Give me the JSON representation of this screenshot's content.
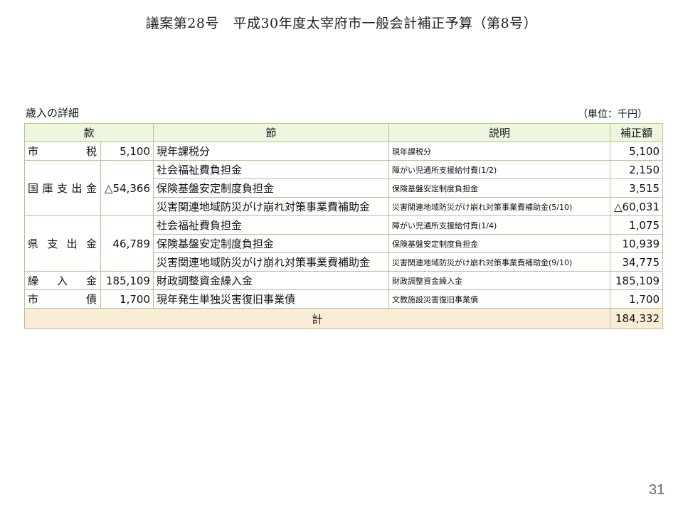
{
  "title": "議案第28号　平成30年度太宰府市一般会計補正予算（第8号）",
  "section_label": "歳入の詳細",
  "unit_label": "（単位：千円）",
  "headers": {
    "kan": "款",
    "setsu": "節",
    "setsumei": "説明",
    "hoseigaku": "補正額"
  },
  "groups": [
    {
      "kan": "市　　税",
      "kan_amount": "5,100",
      "rows": [
        {
          "setsu": "現年課税分",
          "setsumei": "現年課税分",
          "amount": "5,100"
        }
      ]
    },
    {
      "kan": "国庫支出金",
      "kan_amount": "△54,366",
      "rows": [
        {
          "setsu": "社会福祉費負担金",
          "setsumei": "障がい児通所支援給付費(1/2)",
          "amount": "2,150"
        },
        {
          "setsu": "保険基盤安定制度負担金",
          "setsumei": "保険基盤安定制度負担金",
          "amount": "3,515"
        },
        {
          "setsu": "災害関連地域防災がけ崩れ対策事業費補助金",
          "setsumei": "災害関連地域防災がけ崩れ対策事業費補助金(5/10)",
          "amount": "△60,031"
        }
      ]
    },
    {
      "kan": "県支出金",
      "kan_amount": "46,789",
      "rows": [
        {
          "setsu": "社会福祉費負担金",
          "setsumei": "障がい児通所支援給付費(1/4)",
          "amount": "1,075"
        },
        {
          "setsu": "保険基盤安定制度負担金",
          "setsumei": "保険基盤安定制度負担金",
          "amount": "10,939"
        },
        {
          "setsu": "災害関連地域防災がけ崩れ対策事業費補助金",
          "setsumei": "災害関連地域防災がけ崩れ対策事業費補助金(9/10)",
          "amount": "34,775"
        }
      ]
    },
    {
      "kan": "繰入金",
      "kan_amount": "185,109",
      "rows": [
        {
          "setsu": "財政調整資金繰入金",
          "setsumei": "財政調整資金繰入金",
          "amount": "185,109"
        }
      ]
    },
    {
      "kan": "市　　債",
      "kan_amount": "1,700",
      "rows": [
        {
          "setsu": "現年発生単独災害復旧事業債",
          "setsumei": "文教施設災害復旧事業債",
          "amount": "1,700"
        }
      ]
    }
  ],
  "total": {
    "label": "計",
    "amount": "184,332"
  },
  "page_number": "31"
}
